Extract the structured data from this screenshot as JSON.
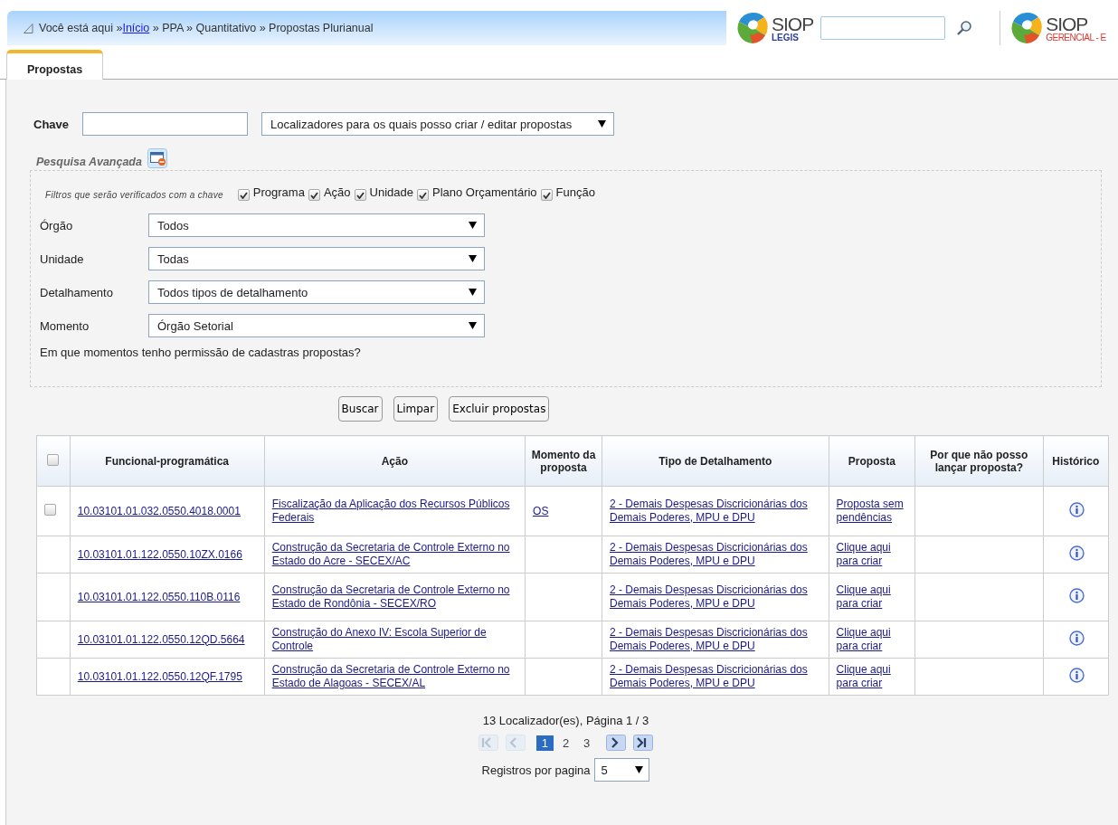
{
  "breadcrumb": {
    "before": "Você está aqui »",
    "link": "Início",
    "after": " » PPA » Quantitativo » Propostas Plurianual"
  },
  "logos": [
    {
      "name": "SIOP",
      "sub": "LEGIS",
      "kind": "legis"
    },
    {
      "name": "SIOP",
      "sub": "GERENCIAL - E",
      "kind": "gerencial"
    }
  ],
  "tabs": [
    {
      "label": "Propostas",
      "selected": true
    }
  ],
  "key": {
    "label": "Chave",
    "scope": "Localizadores para os quais posso criar / editar propostas"
  },
  "advanced": {
    "label": "Pesquisa Avançada",
    "expanded": true
  },
  "filters": {
    "label": "Filtros que serão verificados com a chave",
    "options": [
      {
        "label": "Programa",
        "checked": true
      },
      {
        "label": "Ação",
        "checked": true
      },
      {
        "label": "Unidade",
        "checked": true
      },
      {
        "label": "Plano Orçamentário",
        "checked": true
      },
      {
        "label": "Função",
        "checked": true
      }
    ]
  },
  "selects": [
    {
      "label": "Órgão",
      "value": "Todos"
    },
    {
      "label": "Unidade",
      "value": "Todas"
    },
    {
      "label": "Detalhamento",
      "value": "Todos tipos de detalhamento"
    },
    {
      "label": "Momento",
      "value": "Órgão Setorial"
    }
  ],
  "permission_link": "Em que momentos tenho permissão de cadastras propostas?",
  "buttons": [
    "Buscar",
    "Limpar",
    "Excluir propostas"
  ],
  "table": {
    "select_all_checked": false,
    "columns": [
      "Funcional-programática",
      "Ação",
      "Momento da proposta",
      "Tipo de Detalhamento",
      "Proposta",
      "Por que não posso lançar proposta?",
      "Histórico"
    ],
    "rows": [
      {
        "checkbox": {
          "checked": false
        },
        "code": "10.03101.01.032.0550.4018.0001",
        "action": "Fiscalização da Aplicação dos Recursos Públicos Federais",
        "moment": "OS",
        "detail": "2 - Demais Despesas Discricionárias dos Demais Poderes, MPU e DPU",
        "proposal": "Proposta sem pendências"
      },
      {
        "code": "10.03101.01.122.0550.10ZX.0166",
        "action": "Construção da Secretaria de Controle Externo no Estado do Acre - SECEX/AC",
        "detail": "2 - Demais Despesas Discricionárias dos Demais Poderes, MPU e DPU",
        "proposal": "Clique aqui para criar"
      },
      {
        "code": "10.03101.01.122.0550.110B.0116",
        "action": "Construção da Secretaria de Controle Externo no Estado de Rondônia - SECEX/RO",
        "detail": "2 - Demais Despesas Discricionárias dos Demais Poderes, MPU e DPU",
        "proposal": "Clique aqui para criar"
      },
      {
        "code": "10.03101.01.122.0550.12QD.5664",
        "action": "Construção do Anexo IV: Escola Superior de Controle",
        "detail": "2 - Demais Despesas Discricionárias dos Demais Poderes, MPU e DPU",
        "proposal": "Clique aqui para criar"
      },
      {
        "code": "10.03101.01.122.0550.12QF.1795",
        "action": "Construção da Secretaria de Controle Externo no Estado de Alagoas - SECEX/AL",
        "detail": "2 - Demais Despesas Discricionárias dos Demais Poderes, MPU e DPU",
        "proposal": "Clique aqui para criar"
      }
    ]
  },
  "pagination": {
    "summary": "13 Localizador(es), Página 1 / 3",
    "nav": [
      {
        "kind": "first",
        "disabled": true
      },
      {
        "kind": "prev",
        "disabled": true
      },
      {
        "kind": "next",
        "disabled": false
      },
      {
        "kind": "last",
        "disabled": false
      }
    ],
    "pages": [
      {
        "label": "1",
        "selected": true
      },
      {
        "label": "2",
        "selected": false
      },
      {
        "label": "3",
        "selected": false
      }
    ],
    "per_page_label": "Registros por pagina",
    "per_page": "5"
  }
}
